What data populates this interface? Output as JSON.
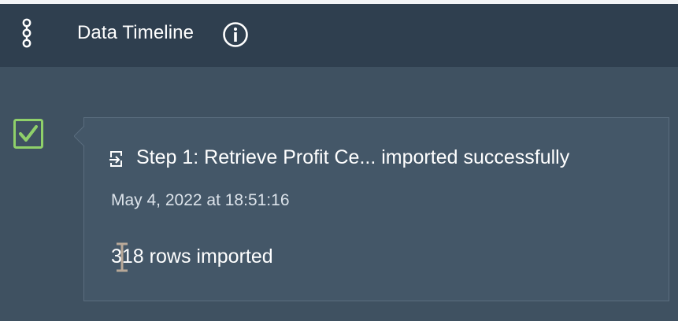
{
  "header": {
    "title": "Data Timeline",
    "icons": {
      "timeline": "timeline-nodes-icon",
      "info": "info-icon"
    }
  },
  "timeline_entry": {
    "status": "success",
    "status_icon": "checkmark-icon",
    "entry_icon": "import-icon",
    "title": "Step 1: Retrieve Profit Ce... imported successfully",
    "timestamp": "May 4, 2022 at 18:51:16",
    "details": "318 rows imported"
  },
  "colors": {
    "header_bg": "#2f3f4f",
    "body_bg": "#3f5161",
    "card_bg": "#445768",
    "card_border": "#5a6d7e",
    "success": "#8fd06a",
    "text_primary": "#ffffff",
    "text_secondary": "#dce3ea"
  }
}
